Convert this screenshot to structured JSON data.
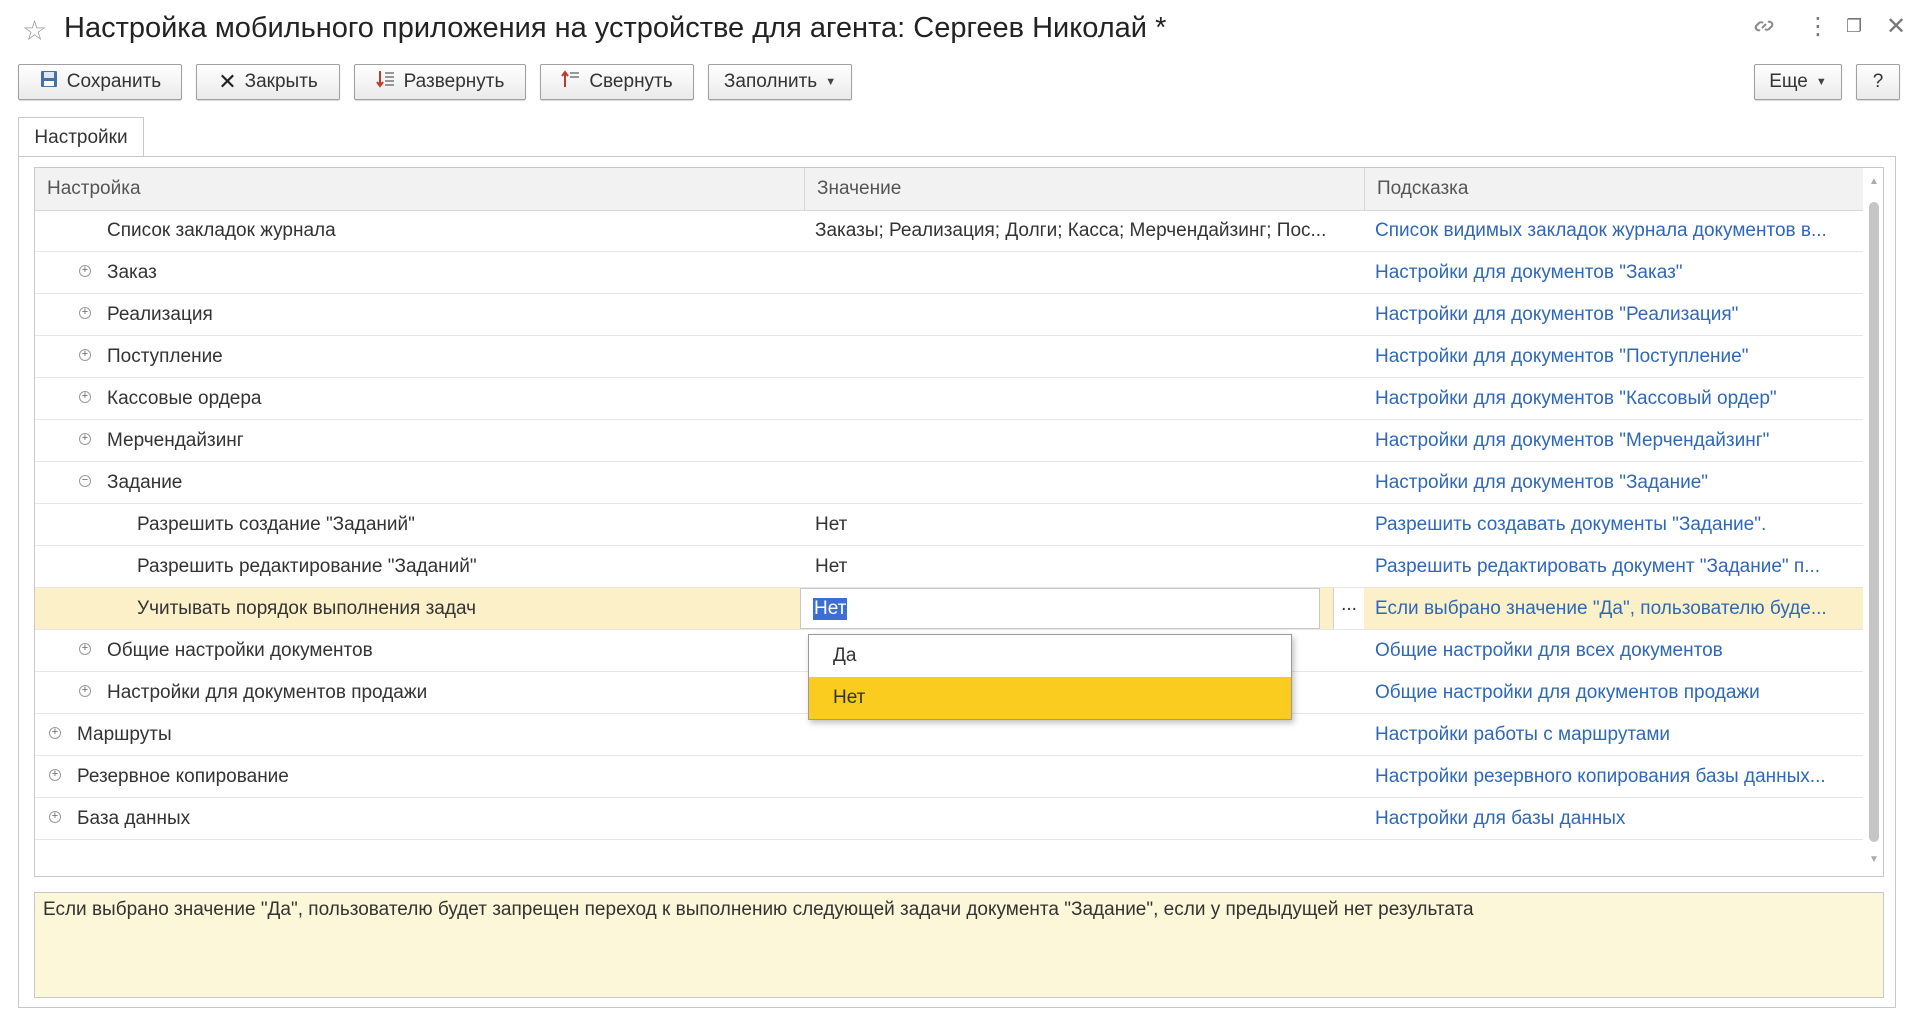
{
  "window": {
    "title": "Настройка мобильного приложения на устройстве для агента: Сергеев Николай *"
  },
  "toolbar": {
    "save": "Сохранить",
    "close": "Закрыть",
    "expand": "Развернуть",
    "collapse": "Свернуть",
    "fill": "Заполнить",
    "more": "Еще",
    "help": "?"
  },
  "tabs": {
    "settings": "Настройки"
  },
  "table": {
    "columns": [
      "Настройка",
      "Значение",
      "Подсказка"
    ],
    "rows": [
      {
        "name": "Список закладок журнала",
        "value": "Заказы; Реализация; Долги; Касса; Мерчендайзинг; Пос...",
        "hint": "Список видимых закладок журнала документов в...",
        "state": "none"
      },
      {
        "name": "Заказ",
        "value": "",
        "hint": "Настройки для документов \"Заказ\"",
        "state": "collapsed"
      },
      {
        "name": "Реализация",
        "value": "",
        "hint": "Настройки для документов \"Реализация\"",
        "state": "collapsed"
      },
      {
        "name": "Поступление",
        "value": "",
        "hint": "Настройки для документов \"Поступление\"",
        "state": "collapsed"
      },
      {
        "name": "Кассовые ордера",
        "value": "",
        "hint": "Настройки для документов \"Кассовый ордер\"",
        "state": "collapsed"
      },
      {
        "name": "Мерчендайзинг",
        "value": "",
        "hint": "Настройки для документов \"Мерчендайзинг\"",
        "state": "collapsed"
      },
      {
        "name": "Задание",
        "value": "",
        "hint": "Настройки для документов \"Задание\"",
        "state": "expanded"
      },
      {
        "name": "Разрешить создание \"Заданий\"",
        "value": "Нет",
        "hint": "Разрешить создавать документы \"Задание\".",
        "state": "none"
      },
      {
        "name": "Разрешить редактирование \"Заданий\"",
        "value": "Нет",
        "hint": "Разрешить редактировать документ \"Задание\" п...",
        "state": "none"
      },
      {
        "name": "Учитывать порядок выполнения задач",
        "value": "Нет",
        "hint": "Если выбрано значение \"Да\", пользователю буде...",
        "state": "none"
      },
      {
        "name": "Общие настройки документов",
        "value": "",
        "hint": "Общие настройки для всех документов",
        "state": "collapsed"
      },
      {
        "name": "Настройки для документов продажи",
        "value": "",
        "hint": "Общие настройки для документов продажи",
        "state": "collapsed"
      },
      {
        "name": "Маршруты",
        "value": "",
        "hint": "Настройки работы с маршрутами",
        "state": "collapsed"
      },
      {
        "name": "Резервное копирование",
        "value": "",
        "hint": "Настройки резервного копирования базы данных...",
        "state": "collapsed"
      },
      {
        "name": "База данных",
        "value": "",
        "hint": "Настройки для базы данных",
        "state": "collapsed"
      }
    ],
    "selected_value_button": "..."
  },
  "dropdown": {
    "options": [
      "Да",
      "Нет"
    ],
    "active": "Нет"
  },
  "hint_panel": {
    "text": "Если выбрано значение \"Да\", пользователю будет запрещен переход к выполнению следующей задачи документа \"Задание\", если у предыдущей нет результата"
  }
}
